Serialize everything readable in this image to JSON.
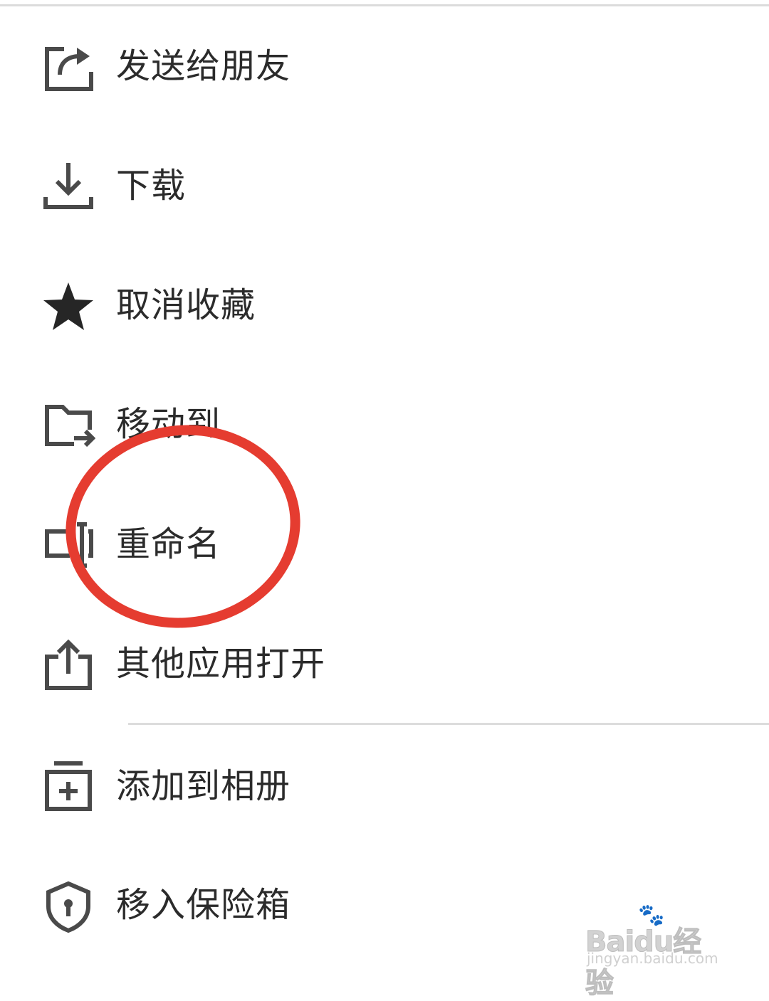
{
  "menu": {
    "items": [
      {
        "label": "发送给朋友",
        "icon": "share-icon"
      },
      {
        "label": "下载",
        "icon": "download-icon"
      },
      {
        "label": "取消收藏",
        "icon": "star-icon"
      },
      {
        "label": "移动到",
        "icon": "move-folder-icon"
      },
      {
        "label": "重命名",
        "icon": "rename-icon"
      },
      {
        "label": "其他应用打开",
        "icon": "open-with-icon"
      },
      {
        "label": "添加到相册",
        "icon": "add-to-album-icon"
      },
      {
        "label": "移入保险箱",
        "icon": "safe-box-icon"
      }
    ]
  },
  "colors": {
    "icon": "#4a4a4a",
    "text": "#2b2b2b",
    "divider": "#dcdcdc",
    "annotation": "#e53c30"
  },
  "watermark": {
    "brand": "Baidu经验",
    "url": "jingyan.baidu.com"
  }
}
